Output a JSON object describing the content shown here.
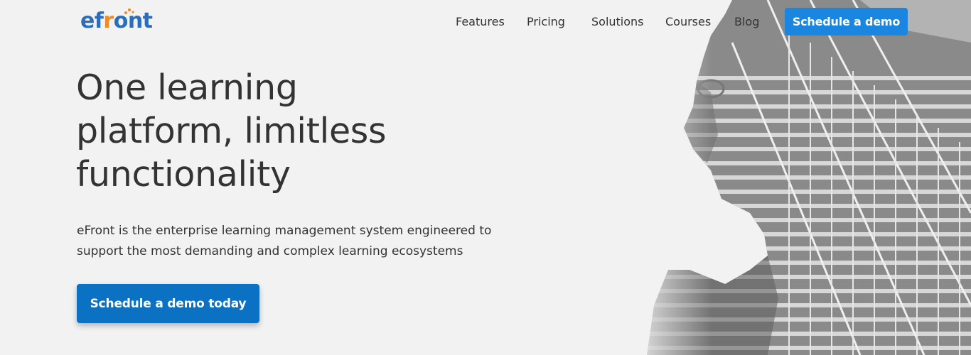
{
  "header": {
    "logo": {
      "part1": "ef",
      "part2": "r",
      "part3": "ont"
    },
    "nav": [
      {
        "label": "Features"
      },
      {
        "label": "Pricing"
      },
      {
        "label": "Solutions"
      },
      {
        "label": "Courses"
      },
      {
        "label": "Blog"
      }
    ],
    "cta_label": "Schedule a demo"
  },
  "hero": {
    "headline_line1": "One learning",
    "headline_line2": "platform, limitless",
    "headline_line3": "functionality",
    "subtitle_line1": "eFront is the enterprise learning management system engineered to",
    "subtitle_line2": "support the most demanding and complex learning ecosystems",
    "cta_label": "Schedule a demo today",
    "image_icon": "person-staircase-photo"
  },
  "colors": {
    "brand_blue": "#2a6ebb",
    "brand_orange": "#f08a24",
    "cta_top": "#1a86e0",
    "cta_main": "#0b71c2",
    "background": "#f2f2f2"
  }
}
